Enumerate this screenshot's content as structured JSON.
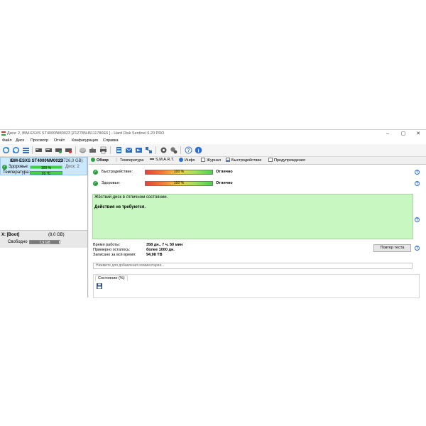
{
  "window": {
    "title": "Диск: 2, IBM-ESXS ST4000NM0023 [Z1Z785H5111780E6    ]  -  Hard Disk Sentinel 6.20 PRO"
  },
  "menu": [
    "Файл",
    "Диск",
    "Просмотр",
    "Отчёт",
    "Конфигурация",
    "Справка"
  ],
  "disk": {
    "name": "IBM-ESXS ST4000NM0023",
    "size": "(3726,0 GB)",
    "health_label": "Здоровье:",
    "health_value": "100 %",
    "health_percent": 100,
    "disk_index": "Диск: 2",
    "temp_label": "Температура:",
    "temp_value": "31 °C"
  },
  "partition": {
    "name": "X: [Boot]",
    "size": "(8,0 GB)",
    "free_label": "Свободно",
    "free_value": "7,9 GB",
    "free_percent": 98
  },
  "tabs": [
    "Обзор",
    "Температура",
    "S.M.A.R.T.",
    "Инфо",
    "Журнал",
    "Быстродействие",
    "Предупреждения"
  ],
  "overview": {
    "performance_label": "Быстродействие:",
    "performance_value": "100 %",
    "performance_status": "Отлично",
    "health_label": "Здоровье:",
    "health_value": "100 %",
    "health_status": "Отлично",
    "message_line1": "Жёсткий диск в отличном состоянии.",
    "message_line2": "Действия не требуются.",
    "uptime_label": "Время работы:",
    "uptime_value": "358 дн., 7 ч, 50 мин",
    "remaining_label": "Примерно осталось:",
    "remaining_value": "более 1000 дн.",
    "written_label": "Записано за всё время:",
    "written_value": "94,98 TB",
    "retest_button": "Повтор теста",
    "comment_placeholder": "Нажмите для добавления комментария...",
    "state_tab": "Состояние (%)"
  },
  "colors": {
    "selection": "#cce8ff",
    "good_box": "#c8f7c1",
    "ok_green": "#2ea043",
    "help_blue": "#2d6fd0"
  }
}
